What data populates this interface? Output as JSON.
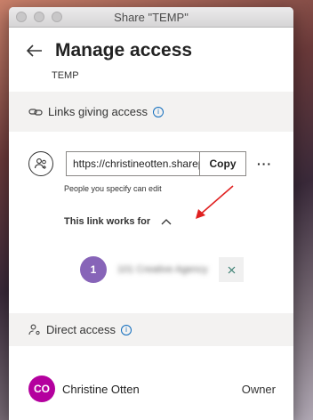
{
  "window": {
    "title": "Share \"TEMP\""
  },
  "header": {
    "title": "Manage access",
    "subtitle": "TEMP"
  },
  "links_section": {
    "label": "Links giving access",
    "link_url": "https://christineotten.sharepoint.com/:f:/g/personal",
    "copy_label": "Copy",
    "more_label": "···",
    "permission_text": "People you specify can edit",
    "works_for_label": "This link works for",
    "recipients": [
      {
        "initial": "1",
        "name": "101 Creative Agency"
      }
    ]
  },
  "direct_section": {
    "label": "Direct access"
  },
  "members": [
    {
      "initials": "CO",
      "name": "Christine Otten",
      "role": "Owner"
    }
  ],
  "colors": {
    "recipient_avatar": "#8764b8",
    "owner_avatar": "#b4009e",
    "accent": "#0f6cbd",
    "annotation_arrow": "#e02020"
  }
}
